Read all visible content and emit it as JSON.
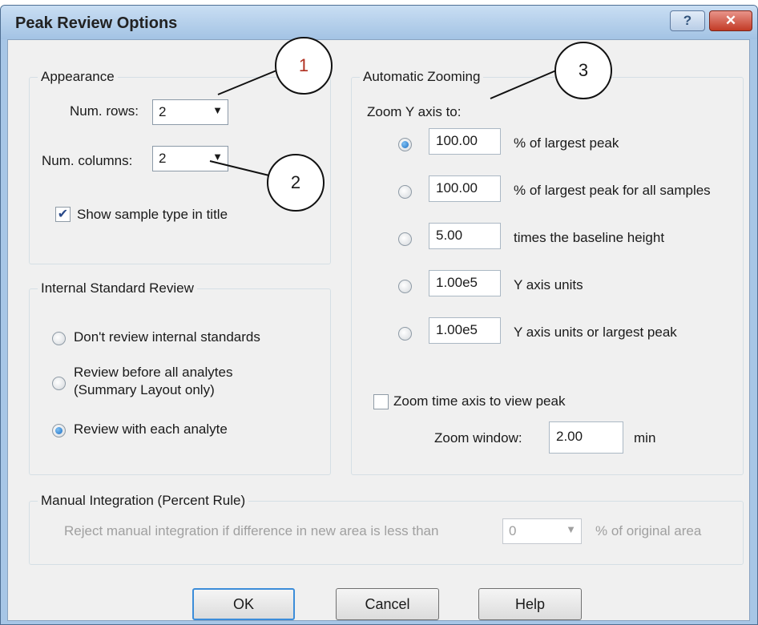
{
  "window": {
    "title": "Peak Review Options",
    "help_glyph": "?",
    "close_glyph": "✕"
  },
  "appearance": {
    "label": "Appearance",
    "rows_label": "Num. rows:",
    "rows_value": "2",
    "columns_label": "Num. columns:",
    "columns_value": "2",
    "show_sample_type_label": "Show sample type in title",
    "show_sample_type_checked": true
  },
  "internal_standard": {
    "label": "Internal Standard Review",
    "options": [
      {
        "label": "Don't review internal standards",
        "selected": false
      },
      {
        "label_line1": "Review before all analytes",
        "label_line2": "(Summary Layout only)",
        "selected": false
      },
      {
        "label": "Review with each analyte",
        "selected": true
      }
    ]
  },
  "zooming": {
    "label": "Automatic Zooming",
    "zoom_y_label": "Zoom Y axis to:",
    "options": [
      {
        "value": "100.00",
        "suffix": "% of largest peak",
        "selected": true
      },
      {
        "value": "100.00",
        "suffix": "% of largest peak for all samples",
        "selected": false
      },
      {
        "value": "5.00",
        "suffix": "times the baseline height",
        "selected": false
      },
      {
        "value": "1.00e5",
        "suffix": "Y axis units",
        "selected": false
      },
      {
        "value": "1.00e5",
        "suffix": "Y axis units or largest peak",
        "selected": false
      }
    ],
    "zoom_time_label": "Zoom time axis to view peak",
    "zoom_time_checked": false,
    "zoom_window_label": "Zoom window:",
    "zoom_window_value": "2.00",
    "zoom_window_unit": "min"
  },
  "manual_integration": {
    "label": "Manual Integration (Percent Rule)",
    "reject_label": "Reject manual integration if difference in new area is less than",
    "percent_value": "0",
    "unit_label": "% of original area"
  },
  "buttons": {
    "ok": "OK",
    "cancel": "Cancel",
    "help": "Help"
  },
  "callouts": [
    "1",
    "2",
    "3"
  ],
  "colors": {
    "title_bar": "#a7c6e6",
    "close_button": "#c23a25",
    "radio_selected": "#1d6fc3",
    "default_button_border": "#3c8dd9",
    "callout_1_text": "#b03020"
  }
}
